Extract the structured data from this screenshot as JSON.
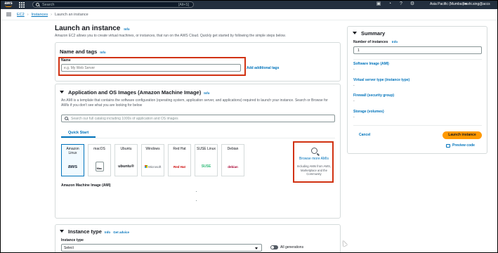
{
  "topnav": {
    "logo": "aws",
    "search_placeholder": "Search",
    "search_shortcut": "[Alt+S]",
    "region": "Asia Pacific (Mumbai) ▾",
    "account": "kashi.sing@accs"
  },
  "breadcrumb": {
    "items": [
      "EC2",
      "Instances",
      "Launch an instance"
    ]
  },
  "page": {
    "title": "Launch an instance",
    "info": "Info",
    "description": "Amazon EC2 allows you to create virtual machines, or instances, that run on the AWS Cloud. Quickly get started by following the simple steps below."
  },
  "name_tags": {
    "header": "Name and tags",
    "info": "Info",
    "name_label": "Name",
    "name_placeholder": "e.g. My Web Server",
    "add_tags": "Add additional tags"
  },
  "ami": {
    "header": "Application and OS Images (Amazon Machine Image)",
    "info": "Info",
    "description": "An AMI is a template that contains the software configuration (operating system, application server, and applications) required to launch your instance. Search or Browse for AMIs if you don't see what you are looking for below",
    "search_placeholder": "Search our full catalog including 1000s of application and OS images",
    "tab": "Quick Start",
    "os_tiles": [
      {
        "name": "Amazon Linux",
        "logo": "aws"
      },
      {
        "name": "macOS",
        "logo": "Mac"
      },
      {
        "name": "Ubuntu",
        "logo": "ubuntu®"
      },
      {
        "name": "Windows",
        "logo": "Microsoft"
      },
      {
        "name": "Red Hat",
        "logo": "Red Hat"
      },
      {
        "name": "SUSE Linux",
        "logo": "SUSE"
      },
      {
        "name": "Debian",
        "logo": "debian"
      }
    ],
    "browse_title": "Browse more AMIs",
    "browse_sub": "Including AMIs from AWS, Marketplace and the Community",
    "ami_label": "Amazon Machine Image (AMI)"
  },
  "instance_type": {
    "header": "Instance type",
    "info": "Info",
    "advice": "Get advice",
    "label": "Instance type",
    "select_value": "Select",
    "toggle_label": "All generations"
  },
  "summary": {
    "header": "Summary",
    "num_instances_label": "Number of instances",
    "info": "Info",
    "num_instances_value": "1",
    "software_image_label": "Software Image (AMI)",
    "software_image_value": "-",
    "server_type_label": "Virtual server type (instance type)",
    "server_type_value": "-",
    "firewall_label": "Firewall (security group)",
    "firewall_value": "-",
    "storage_label": "Storage (volumes)",
    "storage_value": "-",
    "cancel": "Cancel",
    "launch": "Launch instance",
    "preview": "Preview code"
  },
  "colors": {
    "nav_bg": "#232f3e",
    "link": "#0073bb",
    "primary_button": "#ff9900",
    "highlight_box": "#d13212"
  }
}
